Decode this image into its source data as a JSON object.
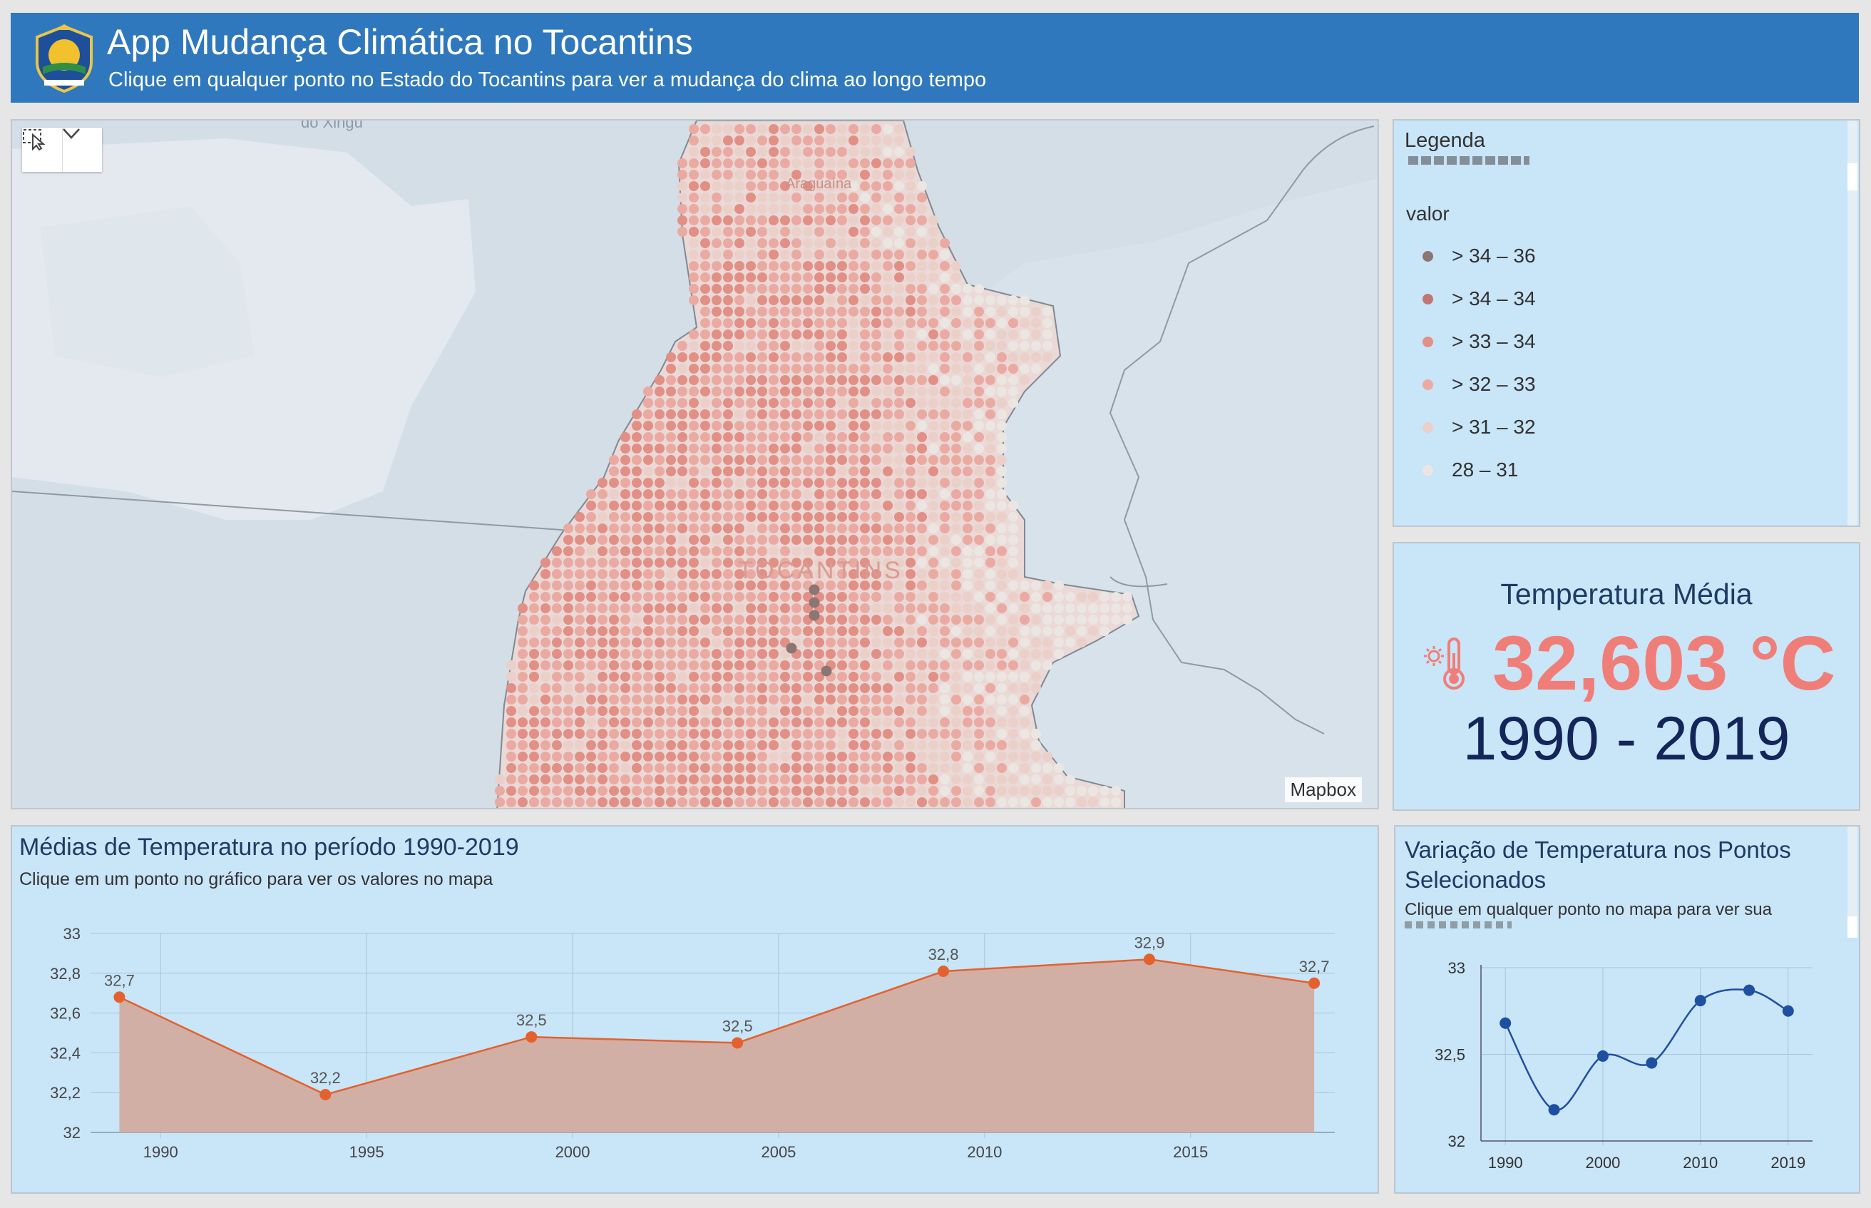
{
  "header": {
    "title": "App Mudança Climática no Tocantins",
    "subtitle": "Clique em qualquer ponto no Estado do Tocantins para ver a mudança do clima ao longo tempo",
    "bg_color": "#2f78bd"
  },
  "map": {
    "attribution": "Mapbox",
    "labels": {
      "state": "TOCANTINS",
      "city": "Araguaína",
      "region": "do Xingu"
    },
    "tools": {
      "select_icon": "select-features-icon",
      "dropdown_icon": "chevron-down-icon"
    }
  },
  "legend": {
    "title": "Legenda",
    "field": "valor",
    "items": [
      {
        "label": "> 34 – 36",
        "color": "#8b7673"
      },
      {
        "label": "> 34 – 34",
        "color": "#c07672"
      },
      {
        "label": "> 33 – 34",
        "color": "#e28f86"
      },
      {
        "label": "> 32 – 33",
        "color": "#eaaaa2"
      },
      {
        "label": "> 31 – 32",
        "color": "#ead0c9"
      },
      {
        "label": "28 – 31",
        "color": "#ece6e2"
      }
    ]
  },
  "indicator": {
    "title": "Temperatura Média",
    "value": "32,603 °C",
    "period": "1990 - 2019",
    "icon": "thermometer-icon",
    "value_color": "#f07e78"
  },
  "chart1_text": {
    "title": "Médias de Temperatura no período 1990-2019",
    "subtitle": "Clique em um ponto no gráfico para ver os valores no mapa"
  },
  "chart2_text": {
    "title": "Variação de Temperatura nos Pontos Selecionados",
    "subtitle": "Clique em qualquer ponto no mapa para ver sua"
  },
  "chart_data": [
    {
      "type": "area",
      "x": [
        1989,
        1994,
        1999,
        2004,
        2009,
        2014,
        2018
      ],
      "values": [
        32.68,
        32.19,
        32.48,
        32.45,
        32.81,
        32.87,
        32.75
      ],
      "data_labels": [
        "32,7",
        "32,2",
        "32,5",
        "32,5",
        "32,8",
        "32,9",
        "32,7"
      ],
      "x_ticks": [
        "1990",
        "1995",
        "2000",
        "2005",
        "2010",
        "2015"
      ],
      "x_tick_values": [
        1990,
        1995,
        2000,
        2005,
        2010,
        2015
      ],
      "y_ticks": [
        "32",
        "32,2",
        "32,4",
        "32,6",
        "32,8",
        "33"
      ],
      "y_tick_values": [
        32,
        32.2,
        32.4,
        32.6,
        32.8,
        33
      ],
      "ylim": [
        32,
        33
      ],
      "xlim": [
        1988.3,
        2018.5
      ],
      "grid": true,
      "line_color": "#e4612e",
      "fill_color": "#d3ac9f"
    },
    {
      "type": "line",
      "x": [
        1990,
        1995,
        2000,
        2005,
        2010,
        2015,
        2019
      ],
      "values": [
        32.68,
        32.18,
        32.49,
        32.45,
        32.81,
        32.87,
        32.75
      ],
      "x_ticks": [
        "1990",
        "2000",
        "2010",
        "2019"
      ],
      "x_tick_values": [
        1990,
        2000,
        2010,
        2019
      ],
      "y_ticks": [
        "32",
        "32,5",
        "33"
      ],
      "y_tick_values": [
        32,
        32.5,
        33
      ],
      "ylim": [
        32,
        33
      ],
      "xlim": [
        1987.5,
        2021.5
      ],
      "grid": true,
      "line_color": "#1f4fa0"
    }
  ]
}
